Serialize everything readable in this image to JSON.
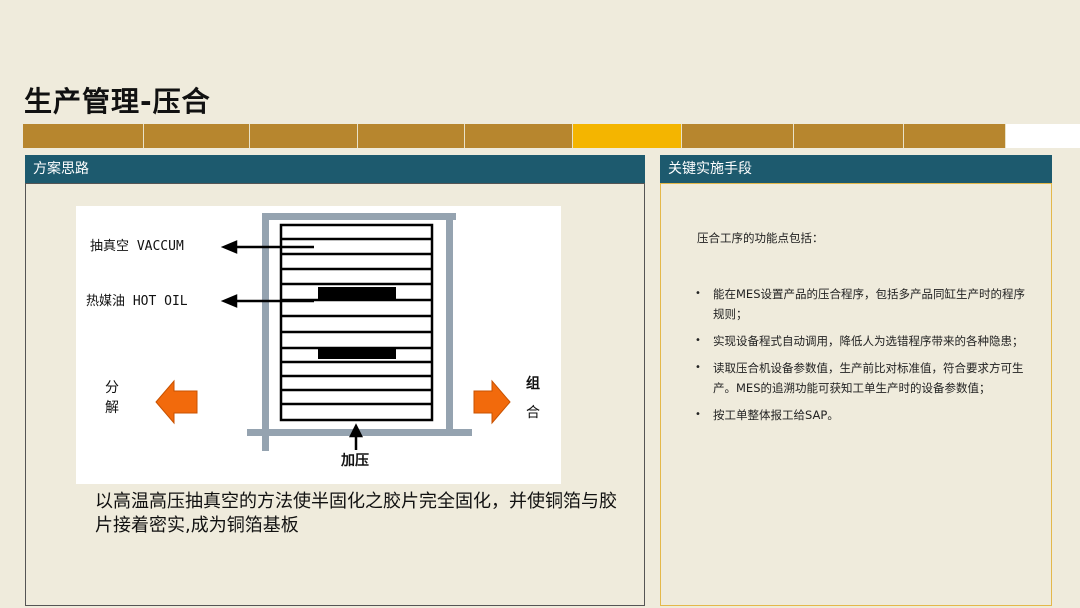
{
  "page": {
    "title": "生产管理-压合"
  },
  "progress": {
    "segments": [
      {
        "color": "#b7862e"
      },
      {
        "color": "#b7862e"
      },
      {
        "color": "#b7862e"
      },
      {
        "color": "#b7862e"
      },
      {
        "color": "#b7862e"
      },
      {
        "color": "#f4b500"
      },
      {
        "color": "#b7862e"
      },
      {
        "color": "#b7862e"
      },
      {
        "color": "#b7862e"
      },
      {
        "color": "#ffffff"
      }
    ]
  },
  "left_panel": {
    "header": "方案思路",
    "diagram": {
      "vacuum_label": "抽真空 VACCUM",
      "oil_label": "热媒油 HOT OIL",
      "split_label": "分解",
      "combine_label": "组合",
      "press_label": "加压"
    },
    "caption": "以高温高压抽真空的方法使半固化之胶片完全固化，并使铜箔与胶片接着密实,成为铜箔基板"
  },
  "right_panel": {
    "header": "关键实施手段",
    "intro": "压合工序的功能点包括：",
    "bullets": [
      "能在MES设置产品的压合程序，包括多产品同缸生产时的程序规则；",
      "实现设备程式自动调用，降低人为选错程序带来的各种隐患；",
      "读取压合机设备参数值，生产前比对标准值，符合要求方可生产。MES的追溯功能可获知工单生产时的设备参数值；",
      "按工单整体报工给SAP。"
    ]
  },
  "colors": {
    "header_bg": "#1d5a6e",
    "segment_gold": "#b7862e",
    "segment_active": "#f4b500",
    "arrow_orange": "#f26a0c",
    "frame_gray": "#95a3b0"
  }
}
